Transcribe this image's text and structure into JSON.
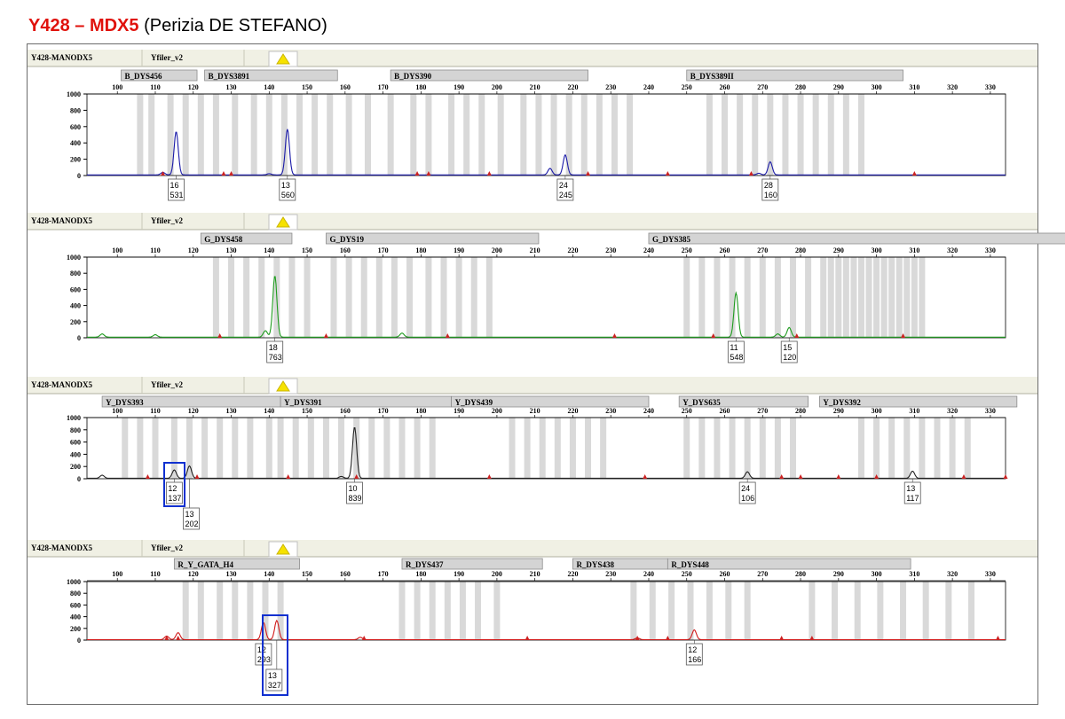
{
  "header": {
    "sample_id": "Y428 – MDX5",
    "case_label": "(Perizia DE STEFANO)"
  },
  "colors": {
    "blue": "#1a1aa8",
    "green": "#1f9c1f",
    "black": "#222222",
    "red": "#d01a1a",
    "highlight_box": "#1030d0",
    "bins": "#d9d9d9",
    "marker_bar": "#d4d4d4"
  },
  "chart_data": [
    {
      "type": "line",
      "sample": "Y428-MANODX5",
      "panel": "Yfiler_v2",
      "dye": "blue",
      "x_ticks": [
        100,
        110,
        120,
        130,
        140,
        150,
        160,
        170,
        180,
        190,
        200,
        210,
        220,
        230,
        240,
        250,
        260,
        270,
        280,
        290,
        300,
        310,
        320,
        330
      ],
      "xlim": [
        92,
        334
      ],
      "ylim": [
        0,
        1000
      ],
      "y_ticks": [
        0,
        200,
        400,
        600,
        800,
        1000
      ],
      "markers": [
        {
          "name": "B_DYS456",
          "start": 101,
          "end": 121
        },
        {
          "name": "B_DYS3891",
          "start": 123,
          "end": 158
        },
        {
          "name": "B_DYS390",
          "start": 172,
          "end": 224
        },
        {
          "name": "B_DYS389II",
          "start": 250,
          "end": 307
        }
      ],
      "bins": [
        106,
        109,
        114,
        118,
        122,
        126,
        131,
        136,
        140,
        144,
        148,
        152,
        156,
        161,
        166,
        172,
        178,
        182,
        188,
        192,
        196,
        201,
        207,
        211,
        215,
        219,
        223,
        227,
        231,
        235,
        256,
        260,
        264,
        268,
        272,
        276,
        280,
        284,
        288,
        292,
        296
      ],
      "peaks": [
        {
          "x": 115.5,
          "height": 531,
          "allele": "16",
          "label_height": "531"
        },
        {
          "x": 144.8,
          "height": 560,
          "allele": "13",
          "label_height": "560"
        },
        {
          "x": 218,
          "height": 245,
          "allele": "24",
          "label_height": "245"
        },
        {
          "x": 272,
          "height": 160,
          "allele": "28",
          "label_height": "160"
        },
        {
          "x": 112,
          "height": 30
        },
        {
          "x": 140,
          "height": 15
        },
        {
          "x": 214,
          "height": 80
        },
        {
          "x": 269,
          "height": 20
        }
      ],
      "tick_marks": [
        112,
        128,
        130,
        179,
        182,
        198,
        224,
        245,
        267,
        310
      ]
    },
    {
      "type": "line",
      "sample": "Y428-MANODX5",
      "panel": "Yfiler_v2",
      "dye": "green",
      "x_ticks": [
        100,
        110,
        120,
        130,
        140,
        150,
        160,
        170,
        180,
        190,
        200,
        210,
        220,
        230,
        240,
        250,
        260,
        270,
        280,
        290,
        300,
        310,
        320,
        330
      ],
      "xlim": [
        92,
        334
      ],
      "ylim": [
        0,
        1000
      ],
      "y_ticks": [
        0,
        200,
        400,
        600,
        800,
        1000
      ],
      "markers": [
        {
          "name": "G_DYS458",
          "start": 122,
          "end": 146
        },
        {
          "name": "G_DYS19",
          "start": 155,
          "end": 211
        },
        {
          "name": "G_DYS385",
          "start": 240,
          "end": 352
        }
      ],
      "bins": [
        126,
        130,
        134,
        138,
        142,
        146,
        150,
        157,
        161,
        165,
        169,
        173,
        177,
        182,
        186,
        190,
        194,
        198,
        250,
        254,
        258,
        262,
        266,
        270,
        274,
        278,
        282,
        286,
        288,
        290,
        292,
        294,
        296,
        298,
        300,
        302,
        304,
        306,
        308,
        310,
        312
      ],
      "peaks": [
        {
          "x": 141.5,
          "height": 763,
          "allele": "18",
          "label_height": "763"
        },
        {
          "x": 263,
          "height": 548,
          "allele": "11",
          "label_height": "548"
        },
        {
          "x": 277,
          "height": 120,
          "allele": "15",
          "label_height": "120"
        },
        {
          "x": 139,
          "height": 80
        },
        {
          "x": 175,
          "height": 50
        },
        {
          "x": 96,
          "height": 40
        },
        {
          "x": 110,
          "height": 30
        },
        {
          "x": 274,
          "height": 40
        }
      ],
      "tick_marks": [
        127,
        155,
        187,
        231,
        257,
        279,
        307
      ]
    },
    {
      "type": "line",
      "sample": "Y428-MANODX5",
      "panel": "Yfiler_v2",
      "dye": "black",
      "x_ticks": [
        100,
        110,
        120,
        130,
        140,
        150,
        160,
        170,
        180,
        190,
        200,
        210,
        220,
        230,
        240,
        250,
        260,
        270,
        280,
        290,
        300,
        310,
        320,
        330
      ],
      "xlim": [
        92,
        334
      ],
      "ylim": [
        0,
        1000
      ],
      "y_ticks": [
        0,
        200,
        400,
        600,
        800,
        1000
      ],
      "markers": [
        {
          "name": "Y_DYS393",
          "start": 96,
          "end": 143
        },
        {
          "name": "Y_DYS391",
          "start": 143,
          "end": 188
        },
        {
          "name": "Y_DYS439",
          "start": 188,
          "end": 240
        },
        {
          "name": "Y_DYS635",
          "start": 248,
          "end": 282
        },
        {
          "name": "Y_DYS392",
          "start": 285,
          "end": 337
        }
      ],
      "bins": [
        102,
        106,
        110,
        115,
        119,
        123,
        127,
        131,
        135,
        140,
        143,
        147,
        151,
        155,
        159,
        163,
        167,
        171,
        175,
        179,
        183,
        204,
        208,
        212,
        216,
        220,
        224,
        228,
        250,
        254,
        258,
        262,
        266,
        270,
        274,
        278,
        296,
        300,
        304,
        308,
        312,
        316,
        320,
        324
      ],
      "peaks": [
        {
          "x": 115,
          "height": 137,
          "allele": "12",
          "label_height": "137"
        },
        {
          "x": 119,
          "height": 202,
          "allele": "13",
          "label_height": "202"
        },
        {
          "x": 162.5,
          "height": 839,
          "allele": "10",
          "label_height": "839"
        },
        {
          "x": 266,
          "height": 106,
          "allele": "24",
          "label_height": "106"
        },
        {
          "x": 309.5,
          "height": 117,
          "allele": "13",
          "label_height": "117"
        },
        {
          "x": 96,
          "height": 50
        },
        {
          "x": 159,
          "height": 30
        }
      ],
      "tick_marks": [
        108,
        121,
        145,
        163,
        198,
        239,
        275,
        280,
        290,
        300,
        323,
        334
      ]
    },
    {
      "type": "line",
      "sample": "Y428-MANODX5",
      "panel": "Yfiler_v2",
      "dye": "red",
      "x_ticks": [
        100,
        110,
        120,
        130,
        140,
        150,
        160,
        170,
        180,
        190,
        200,
        210,
        220,
        230,
        240,
        250,
        260,
        270,
        280,
        290,
        300,
        310,
        320,
        330
      ],
      "xlim": [
        92,
        334
      ],
      "ylim": [
        0,
        1000
      ],
      "y_ticks": [
        0,
        200,
        400,
        600,
        800,
        1000
      ],
      "markers": [
        {
          "name": "R_Y_GATA_H4",
          "start": 115,
          "end": 148
        },
        {
          "name": "R_DYS437",
          "start": 175,
          "end": 212
        },
        {
          "name": "R_DYS438",
          "start": 220,
          "end": 245
        },
        {
          "name": "R_DYS448",
          "start": 245,
          "end": 309
        }
      ],
      "bins": [
        118,
        122,
        127,
        131,
        135,
        139,
        143,
        175,
        179,
        183,
        187,
        191,
        195,
        200,
        236,
        241,
        246,
        251,
        256,
        261,
        266,
        283,
        289,
        295,
        301,
        307,
        313,
        319,
        325
      ],
      "peaks": [
        {
          "x": 138.5,
          "height": 293,
          "allele": "12",
          "label_height": "293"
        },
        {
          "x": 142,
          "height": 327,
          "allele": "13",
          "label_height": "327"
        },
        {
          "x": 252,
          "height": 166,
          "allele": "12",
          "label_height": "166"
        },
        {
          "x": 116,
          "height": 120
        },
        {
          "x": 113,
          "height": 60
        },
        {
          "x": 164,
          "height": 40
        },
        {
          "x": 237,
          "height": 30
        }
      ],
      "tick_marks": [
        113,
        116,
        165,
        208,
        237,
        245,
        275,
        283,
        332
      ]
    }
  ]
}
